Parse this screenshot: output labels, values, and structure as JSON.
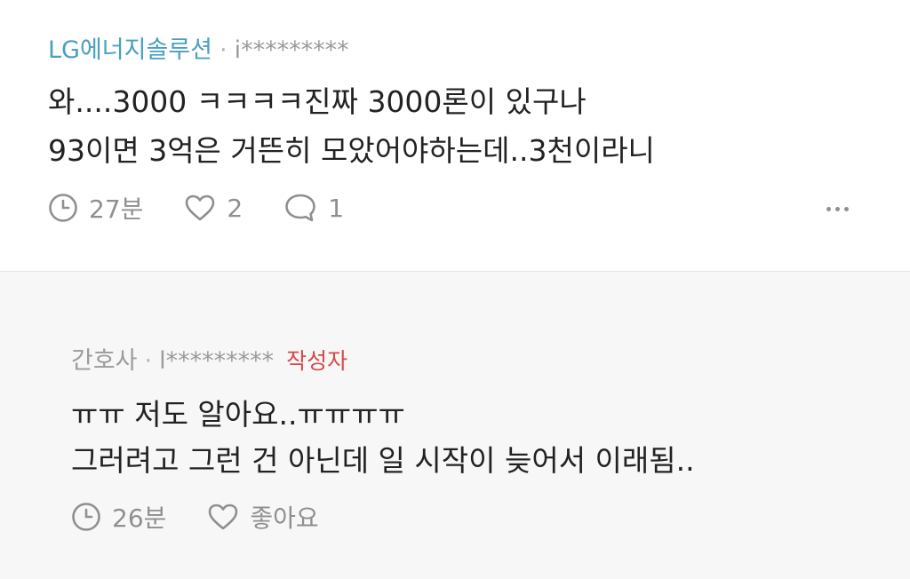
{
  "comments": [
    {
      "author": "LG에너지솔루션",
      "separator": "·",
      "user_id": "i*********",
      "lines": [
        "와....3000 ㅋㅋㅋㅋ진짜 3000론이 있구나",
        "93이면 3억은 거뜬히 모았어야하는데..3천이라니"
      ],
      "time": "27분",
      "likes": "2",
      "replies": "1"
    },
    {
      "author": "간호사",
      "separator": "·",
      "user_id": "l*********",
      "badge": "작성자",
      "lines": [
        "ㅠㅠ 저도 알아요..ㅠㅠㅠㅠ",
        "그러려고 그런 건 아닌데 일 시작이 늦어서 이래됨.."
      ],
      "time": "26분",
      "like_label": "좋아요"
    }
  ],
  "colors": {
    "author_highlight": "#4aa0bf",
    "writer_badge": "#d44a4a",
    "icon_gray": "#8f8f8f",
    "reply_background": "#f7f7f7"
  },
  "icons": [
    "clock-icon",
    "heart-icon",
    "speech-bubble-icon",
    "more-dots-icon"
  ]
}
